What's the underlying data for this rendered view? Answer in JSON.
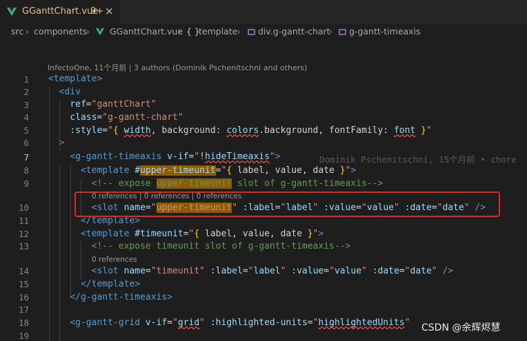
{
  "tab": {
    "filename": "GGanttChart.vue",
    "badge": "9+",
    "close": "×"
  },
  "breadcrumb": {
    "items": [
      "src",
      "components",
      "GGanttChart.vue",
      "template",
      "div.g-gantt-chart",
      "g-gantt-timeaxis"
    ],
    "template_prefix": "{ }"
  },
  "blame_header": "InfectoOne, 11个月前 | 3 authors (Dominik Pschenitschni and others)",
  "inline_blame": "Dominik Pschenitschni, 15个月前 • chore",
  "line_numbers": [
    "1",
    "2",
    "3",
    "4",
    "5",
    "6",
    "7",
    "8",
    "9",
    "10",
    "11",
    "12",
    "13",
    "14",
    "15",
    "16",
    "17",
    "18",
    "19"
  ],
  "code_lens": {
    "line10": "0 references | 0 references | 0 references",
    "line13": "0 references",
    "line14": "0 references"
  },
  "watermark": "CSDN @余辉烬慧",
  "colors": {
    "accent_highlight": "#8a5c05",
    "box": "#e3271d",
    "tab_text": "#e2c08d",
    "vue": "#41b883"
  }
}
